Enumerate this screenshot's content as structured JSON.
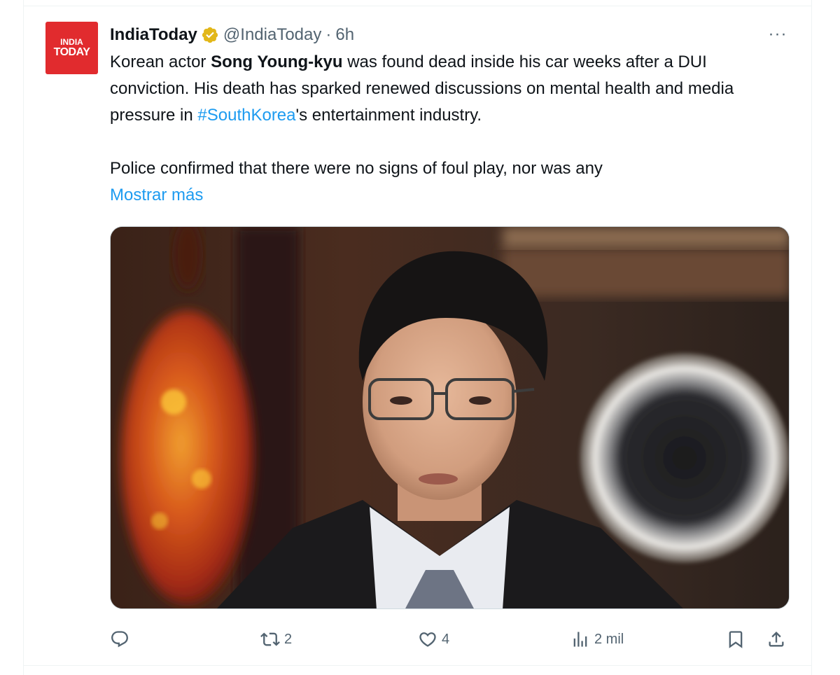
{
  "avatar": {
    "line1": "INDIA",
    "line2": "TODAY",
    "color": "#e12b2e"
  },
  "tweet": {
    "display_name": "IndiaToday",
    "handle": "@IndiaToday",
    "separator": "·",
    "time": "6h",
    "more_label": "···",
    "text": {
      "p1_a": "Korean actor ",
      "p1_bold": "Song Young-kyu",
      "p1_b": " was found dead inside his car weeks after a DUI conviction. His death has sparked renewed discussions on mental health and media pressure in ",
      "p1_hashtag": "#SouthKorea",
      "p1_c": "'s entertainment industry.",
      "p2": "Police confirmed that there were no signs of foul play, nor was any"
    },
    "show_more": "Mostrar más"
  },
  "actions": {
    "reply_count": "",
    "retweet_count": "2",
    "like_count": "4",
    "views_count": "2 mil"
  },
  "colors": {
    "link": "#1d9bf0",
    "secondary_text": "#536471",
    "verified_badge": "#e2b719",
    "border": "#eff3f4"
  },
  "icons": {
    "verified": "verified-badge-icon",
    "more": "more-icon",
    "reply": "reply-icon",
    "retweet": "retweet-icon",
    "like": "heart-icon",
    "views": "views-chart-icon",
    "bookmark": "bookmark-icon",
    "share": "share-icon"
  }
}
